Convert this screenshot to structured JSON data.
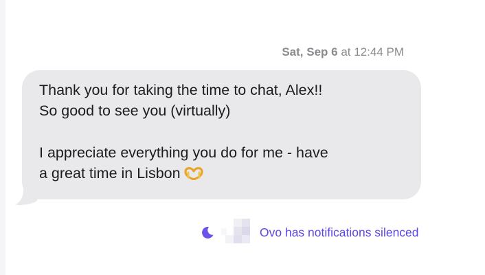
{
  "conversation": {
    "timestamp": {
      "date": "Sat, Sep 6",
      "time": "at 12:44 PM"
    },
    "message": {
      "lines": [
        "Thank you for taking the time to chat, Alex!!",
        "So good to see you (virtually)",
        "I appreciate everything you do for me - have",
        "a great time in Lisbon"
      ],
      "emoji_icon": "heart-hands-icon"
    },
    "status": {
      "icon": "moon-icon",
      "avatar": "pixelated-avatar",
      "text": "Ovo has notifications silenced",
      "accent_color": "#5b47e8"
    }
  }
}
